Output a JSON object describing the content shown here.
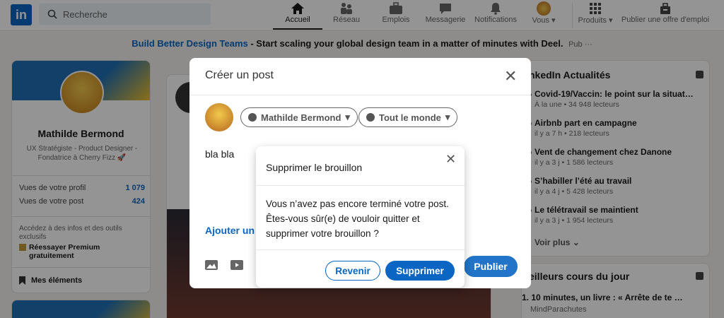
{
  "nav": {
    "logo": "in",
    "search_placeholder": "Recherche",
    "items": [
      {
        "label": "Accueil",
        "icon": "home-icon"
      },
      {
        "label": "Réseau",
        "icon": "network-icon"
      },
      {
        "label": "Emplois",
        "icon": "briefcase-icon"
      },
      {
        "label": "Messagerie",
        "icon": "message-icon"
      },
      {
        "label": "Notifications",
        "icon": "bell-icon"
      },
      {
        "label": "Vous",
        "icon": "avatar-icon"
      },
      {
        "label": "Produits",
        "icon": "grid-icon"
      },
      {
        "label": "Publier une offre d'emploi",
        "icon": "post-job-icon"
      }
    ]
  },
  "ad": {
    "link": "Build Better Design Teams",
    "text": " - Start scaling your global design team in a matter of minutes with Deel.",
    "pub": "Pub ···"
  },
  "profile": {
    "name": "Mathilde Bermond",
    "headline": "UX Stratégiste - Product Designer - Fondatrice à Cherry Fizz 🚀",
    "stats": [
      {
        "label": "Vues de votre profil",
        "value": "1 079"
      },
      {
        "label": "Vues de votre post",
        "value": "424"
      }
    ],
    "premium_text": "Accédez à des infos et des outils exclusifs",
    "premium_cta": "Réessayer Premium gratuitement",
    "saved": "Mes éléments"
  },
  "composer": {
    "title": "Créer un post",
    "author_pill": "Mathilde Bermond",
    "audience_pill": "Tout le monde",
    "text": "bla bla",
    "hashtag": "Ajouter un",
    "publish": "Publier"
  },
  "dialog": {
    "title": "Supprimer le brouillon",
    "body": "Vous n’avez pas encore terminé votre post. Êtes-vous sûr(e) de vouloir quitter et supprimer votre brouillon ?",
    "secondary": "Revenir",
    "primary": "Supprimer"
  },
  "news": {
    "title": "nkedIn Actualités",
    "items": [
      {
        "headline": "Covid-19/Vaccin: le point sur la situat…",
        "meta": "À la une • 34 948 lecteurs"
      },
      {
        "headline": "Airbnb part en campagne",
        "meta": "il y a 7 h • 218 lecteurs"
      },
      {
        "headline": "Vent de changement chez Danone",
        "meta": "il y a 3 j • 1 586 lecteurs"
      },
      {
        "headline": "S’habiller l’été au travail",
        "meta": "il y a 4 j • 5 428 lecteurs"
      },
      {
        "headline": "Le télétravail se maintient",
        "meta": "il y a 3 j • 1 954 lecteurs"
      }
    ],
    "more": "Voir plus"
  },
  "courses": {
    "title": "eilleurs cours du jour",
    "item": "1. 10 minutes, un livre : « Arrête de te …",
    "author": "MindParachutes"
  },
  "colors": {
    "accent": "#0a66c2",
    "overlay": "rgba(0,0,0,0.42)"
  }
}
